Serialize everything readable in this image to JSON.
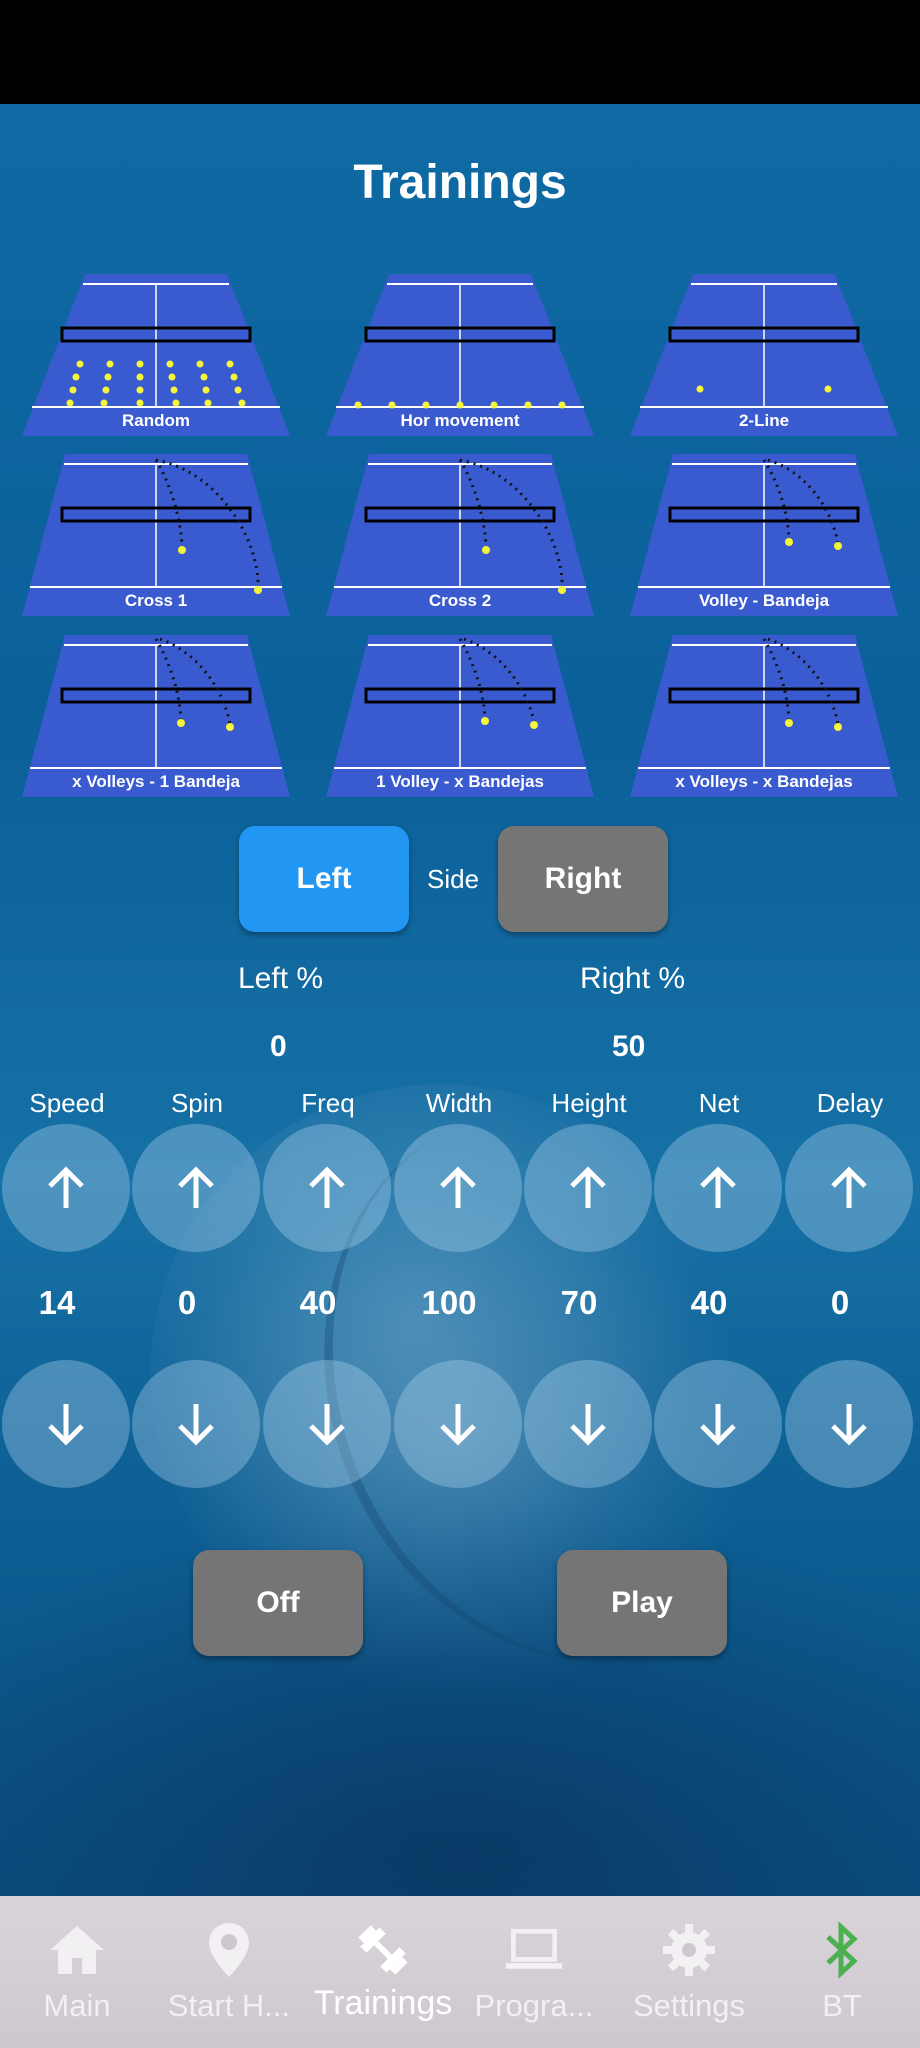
{
  "page": {
    "title": "Trainings"
  },
  "trainings": [
    {
      "label": "Random"
    },
    {
      "label": "Hor movement"
    },
    {
      "label": "2-Line"
    },
    {
      "label": "Cross 1"
    },
    {
      "label": "Cross 2"
    },
    {
      "label": "Volley - Bandeja"
    },
    {
      "label": "x Volleys - 1 Bandeja"
    },
    {
      "label": "1 Volley - x Bandejas"
    },
    {
      "label": "x Volleys - x Bandejas"
    }
  ],
  "side": {
    "left_label": "Left",
    "middle_label": "Side",
    "right_label": "Right",
    "selected": "Left"
  },
  "percent": {
    "left_label": "Left %",
    "right_label": "Right %",
    "left_value": "0",
    "right_value": "50"
  },
  "controls": [
    {
      "label": "Speed",
      "value": "14"
    },
    {
      "label": "Spin",
      "value": "0"
    },
    {
      "label": "Freq",
      "value": "40"
    },
    {
      "label": "Width",
      "value": "100"
    },
    {
      "label": "Height",
      "value": "70"
    },
    {
      "label": "Net",
      "value": "40"
    },
    {
      "label": "Delay",
      "value": "0"
    }
  ],
  "actions": {
    "off_label": "Off",
    "play_label": "Play"
  },
  "nav": [
    {
      "label": "Main",
      "icon": "home-icon"
    },
    {
      "label": "Start H...",
      "icon": "location-pin-icon"
    },
    {
      "label": "Trainings",
      "icon": "dumbbell-icon",
      "active": true
    },
    {
      "label": "Progra...",
      "icon": "laptop-icon"
    },
    {
      "label": "Settings",
      "icon": "gear-icon"
    },
    {
      "label": "BT",
      "icon": "bluetooth-icon"
    }
  ],
  "colors": {
    "court": "#3a5bd0",
    "ball": "#f5f53a",
    "accent": "#2196f3",
    "gray_button": "#757575",
    "bluetooth": "#4caf50"
  }
}
